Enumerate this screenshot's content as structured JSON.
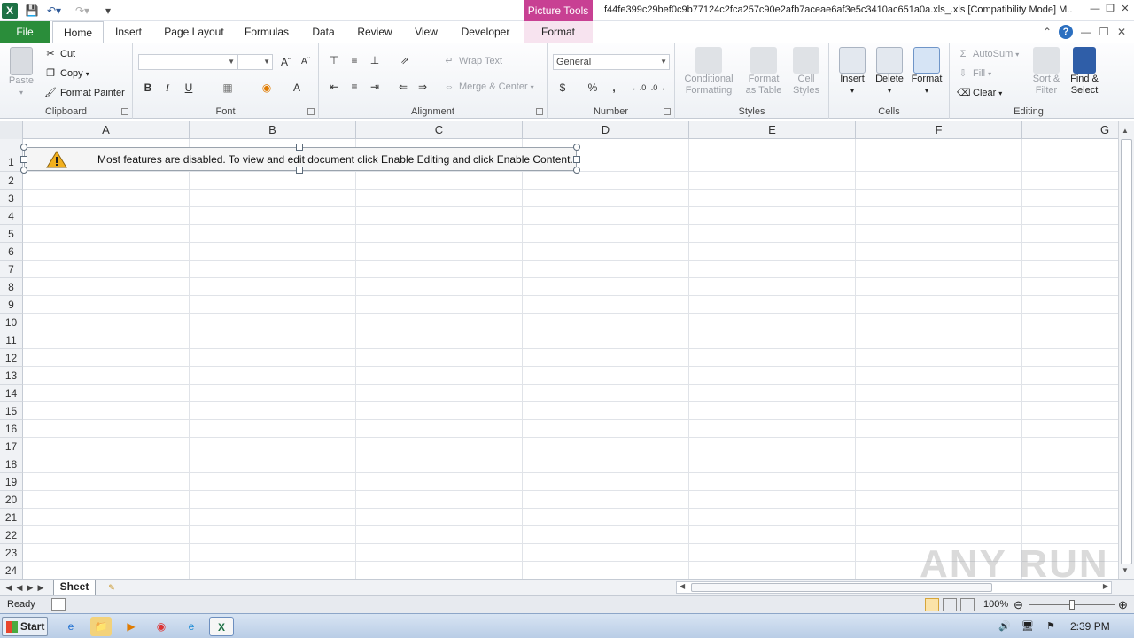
{
  "titlebar": {
    "picture_tools": "Picture Tools",
    "title": "f44fe399c29bef0c9b77124c2fca257c90e2afb7aceae6af3e5c3410ac651a0a.xls_.xls  [Compatibility Mode] M.."
  },
  "tabs": {
    "file": "File",
    "home": "Home",
    "insert": "Insert",
    "page_layout": "Page Layout",
    "formulas": "Formulas",
    "data": "Data",
    "review": "Review",
    "view": "View",
    "developer": "Developer",
    "format": "Format"
  },
  "ribbon": {
    "clipboard": {
      "label": "Clipboard",
      "paste": "Paste",
      "cut": "Cut",
      "copy": "Copy",
      "format_painter": "Format Painter"
    },
    "font": {
      "label": "Font"
    },
    "alignment": {
      "label": "Alignment",
      "wrap_text": "Wrap Text",
      "merge_center": "Merge & Center"
    },
    "number": {
      "label": "Number",
      "format_value": "General",
      "currency": "$",
      "percent": "%",
      "comma": ","
    },
    "styles": {
      "label": "Styles",
      "conditional_1": "Conditional",
      "conditional_2": "Formatting",
      "format_table_1": "Format",
      "format_table_2": "as Table",
      "cell_styles_1": "Cell",
      "cell_styles_2": "Styles"
    },
    "cells": {
      "label": "Cells",
      "insert": "Insert",
      "delete": "Delete",
      "format": "Format"
    },
    "editing": {
      "label": "Editing",
      "autosum": "AutoSum",
      "fill": "Fill",
      "clear": "Clear",
      "sort_1": "Sort &",
      "sort_2": "Filter",
      "find_1": "Find &",
      "find_2": "Select"
    }
  },
  "columns": [
    "A",
    "B",
    "C",
    "D",
    "E",
    "F",
    "G"
  ],
  "rows": [
    "1",
    "2",
    "3",
    "4",
    "5",
    "6",
    "7",
    "8",
    "9",
    "10",
    "11",
    "12",
    "13",
    "14",
    "15",
    "16",
    "17",
    "18",
    "19",
    "20",
    "21",
    "22",
    "23",
    "24"
  ],
  "banner": {
    "text": "Most features are disabled. To view and edit document click Enable Editing and click Enable Content."
  },
  "sheet_tab": "Sheet",
  "status": {
    "ready": "Ready",
    "zoom": "100%"
  },
  "taskbar": {
    "start": "Start",
    "clock": "2:39 PM"
  },
  "watermark": "ANY RUN"
}
